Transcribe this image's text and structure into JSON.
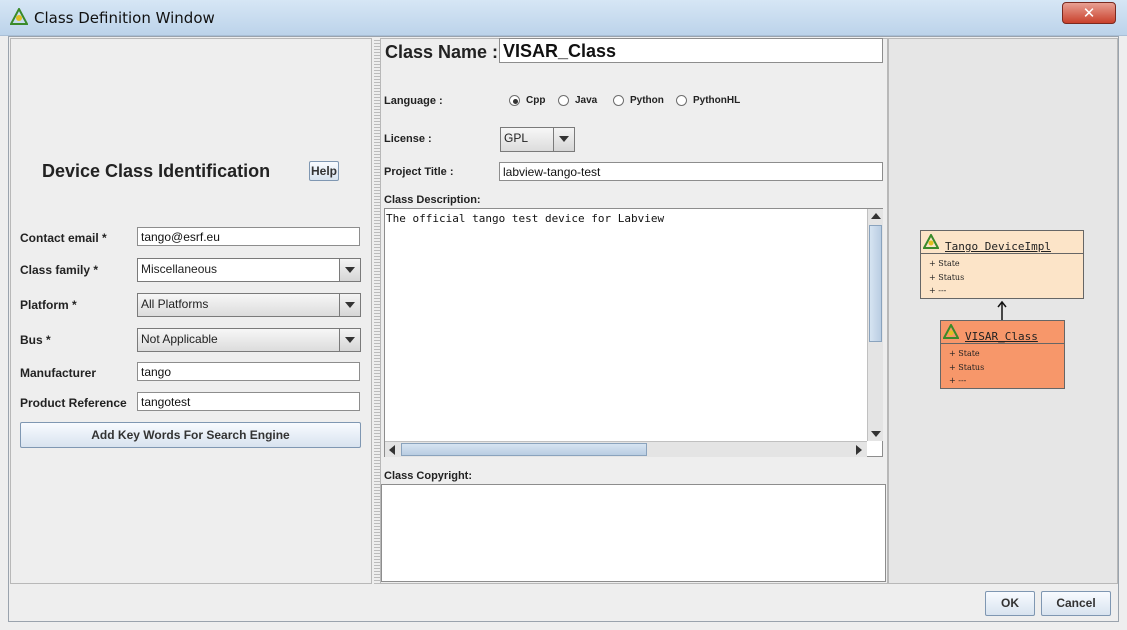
{
  "window": {
    "title": "Class Definition Window",
    "close_label": "✕"
  },
  "left": {
    "heading": "Device Class Identification",
    "help_label": "Help",
    "fields": {
      "contact_email": {
        "label": "Contact email *",
        "value": "tango@esrf.eu"
      },
      "class_family": {
        "label": "Class family *",
        "value": "Miscellaneous"
      },
      "platform": {
        "label": "Platform *",
        "value": "All Platforms"
      },
      "bus": {
        "label": "Bus *",
        "value": "Not Applicable"
      },
      "manufacturer": {
        "label": "Manufacturer",
        "value": "tango"
      },
      "product_reference": {
        "label": "Product Reference",
        "value": "tangotest"
      }
    },
    "keywords_button": "Add Key Words For Search Engine"
  },
  "center": {
    "class_name_label": "Class Name :",
    "class_name": "VISAR_Class",
    "language_label": "Language :",
    "languages": [
      {
        "label": "Cpp",
        "selected": true
      },
      {
        "label": "Java",
        "selected": false
      },
      {
        "label": "Python",
        "selected": false
      },
      {
        "label": "PythonHL",
        "selected": false
      }
    ],
    "license_label": "License :",
    "license": "GPL",
    "project_title_label": "Project Title :",
    "project_title": "labview-tango-test",
    "description_label": "Class Description:",
    "description": "The official tango test device for Labview",
    "copyright_label": "Class Copyright:",
    "copyright": ""
  },
  "diagram": {
    "parent": {
      "name": "Tango DeviceImpl",
      "items": [
        "+ State",
        "+ Status",
        "+ ---"
      ],
      "color": "#fce4c8"
    },
    "child": {
      "name": "VISAR_Class",
      "items": [
        "+ State",
        "+ Status",
        "+ ---"
      ],
      "color": "#f7976a"
    }
  },
  "footer": {
    "ok_label": "OK",
    "cancel_label": "Cancel"
  }
}
